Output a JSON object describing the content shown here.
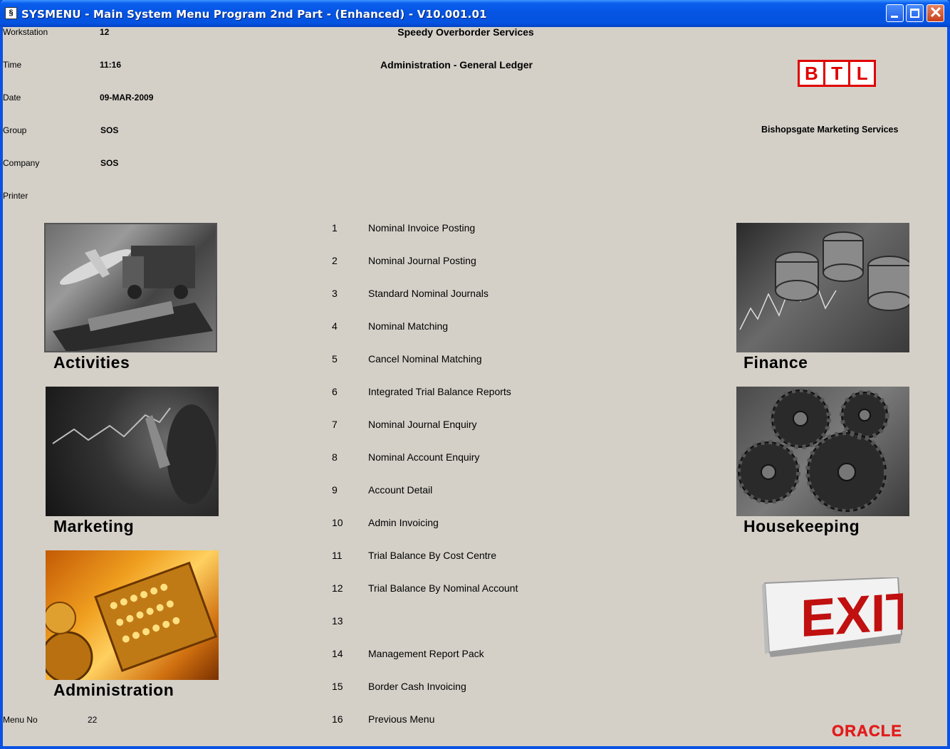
{
  "window": {
    "title": "SYSMENU - Main System Menu Program 2nd Part - (Enhanced) - V10.001.01",
    "icon": "app-icon"
  },
  "info": {
    "workstation_label": "Workstation",
    "workstation_value": "12",
    "time_label": "Time",
    "time_value": "11:16",
    "date_label": "Date",
    "date_value": "09-MAR-2009",
    "group_label": "Group",
    "group_value": "SOS",
    "company_label": "Company",
    "company_value": "SOS",
    "printer_label": "Printer",
    "printer_value": "",
    "menu_no_label": "Menu No",
    "menu_no_value": "22"
  },
  "header": {
    "company_name": "Speedy Overborder Services",
    "menu_title": "Administration - General Ledger",
    "partner_name": "Bishopsgate Marketing Services",
    "logo_letters": [
      "B",
      "T",
      "L"
    ],
    "oracle_logo": "ORACLE"
  },
  "tiles": {
    "activities": "Activities",
    "marketing": "Marketing",
    "administration": "Administration",
    "finance": "Finance",
    "housekeeping": "Housekeeping",
    "exit": "EXIT"
  },
  "menu": [
    {
      "num": "1",
      "label": "Nominal Invoice Posting"
    },
    {
      "num": "2",
      "label": "Nominal Journal Posting"
    },
    {
      "num": "3",
      "label": "Standard Nominal Journals"
    },
    {
      "num": "4",
      "label": "Nominal Matching"
    },
    {
      "num": "5",
      "label": "Cancel Nominal Matching"
    },
    {
      "num": "6",
      "label": "Integrated Trial Balance Reports"
    },
    {
      "num": "7",
      "label": "Nominal Journal Enquiry"
    },
    {
      "num": "8",
      "label": "Nominal Account Enquiry"
    },
    {
      "num": "9",
      "label": "Account Detail"
    },
    {
      "num": "10",
      "label": "Admin Invoicing"
    },
    {
      "num": "11",
      "label": "Trial Balance By Cost Centre"
    },
    {
      "num": "12",
      "label": "Trial Balance By Nominal Account"
    },
    {
      "num": "13",
      "label": ""
    },
    {
      "num": "14",
      "label": "Management Report Pack"
    },
    {
      "num": "15",
      "label": "Border Cash Invoicing"
    },
    {
      "num": "16",
      "label": "Previous Menu"
    }
  ],
  "colors": {
    "titlebar": "#0553e1",
    "background": "#d4d0c8",
    "brand_red": "#e00000"
  }
}
